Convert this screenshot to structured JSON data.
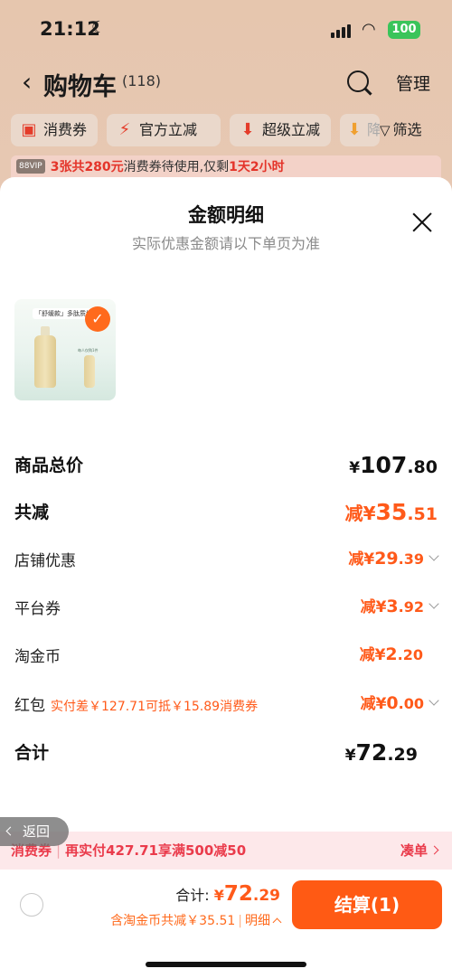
{
  "status_bar": {
    "time": "21:12",
    "battery": "100"
  },
  "nav": {
    "title": "购物车",
    "count": "(118)",
    "manage": "管理"
  },
  "chips": [
    {
      "label": "消费券",
      "icon": "coupon-icon"
    },
    {
      "label": "官方立减",
      "icon": "lightning-icon"
    },
    {
      "label": "超级立减",
      "icon": "down-arrow-icon"
    },
    {
      "label": "降",
      "icon": "down-arrow-icon"
    }
  ],
  "filter_label": "筛选",
  "vip_banner": {
    "badge": "88VIP",
    "highlight": "3张共280元",
    "text1": "消费券待使用,仅剩",
    "highlight2": "1天2小时"
  },
  "sheet": {
    "title": "金额明细",
    "subtitle": "实际优惠金额请以下单页为准",
    "product_tag": "「舒缓款」多肽质地",
    "product_caption": "每人仅购1件"
  },
  "rows": {
    "total_goods": {
      "label": "商品总价",
      "yen": "¥",
      "int": "107",
      "dec": ".80"
    },
    "total_reduce": {
      "label": "共减",
      "prefix": "减¥",
      "int": "35",
      "dec": ".51"
    },
    "store_discount": {
      "label": "店铺优惠",
      "prefix": "减¥",
      "int": "29",
      "dec": ".39"
    },
    "platform_coupon": {
      "label": "平台券",
      "prefix": "减¥",
      "int": "3",
      "dec": ".92"
    },
    "taojinbi": {
      "label": "淘金币",
      "prefix": "减¥",
      "int": "2",
      "dec": ".20"
    },
    "red_packet": {
      "label": "红包",
      "note": "实付差￥127.71可抵￥15.89消费券",
      "prefix": "减¥",
      "int": "0",
      "dec": ".00"
    },
    "subtotal": {
      "label": "合计",
      "yen": "¥",
      "int": "72",
      "dec": ".29"
    }
  },
  "return_label": "返回",
  "coupon_bar": {
    "left1": "消费券",
    "left2": "再实付427.71享满500减50",
    "right": "凑单"
  },
  "footer": {
    "total_label": "合计: ",
    "total_yen": "¥",
    "total_int": "72",
    "total_dec": ".29",
    "sub_text": "含淘金币共减￥35.51",
    "detail": "明细",
    "checkout": "结算(1)"
  },
  "colors": {
    "accent": "#ff5a14",
    "discount_text": "#ff5a1a",
    "coupon_red": "#ea3b4b",
    "battery_green": "#3ac45a"
  }
}
